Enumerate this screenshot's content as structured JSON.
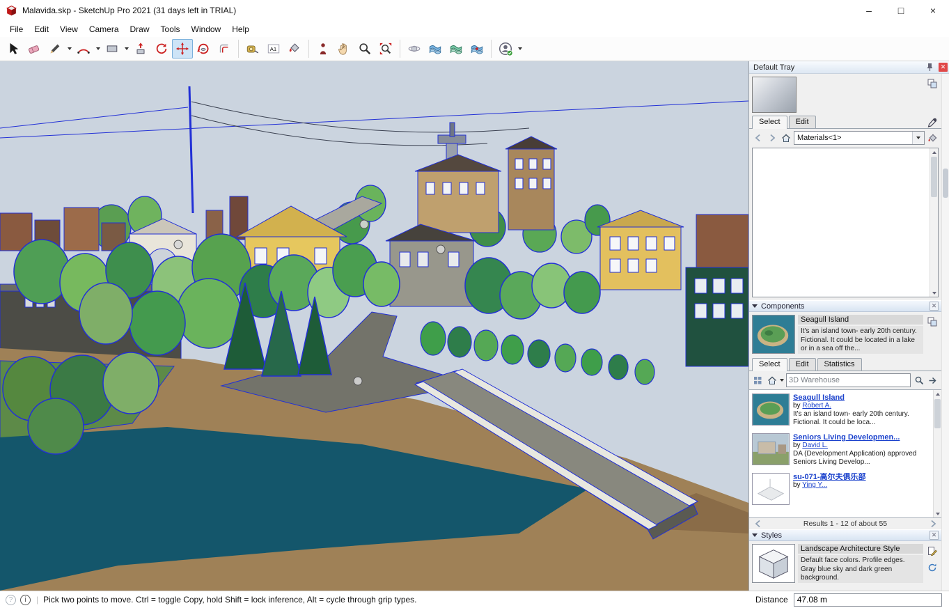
{
  "window": {
    "title": "Malavida.skp - SketchUp Pro 2021 (31 days left in TRIAL)",
    "controls": {
      "minimize": "–",
      "maximize": "□",
      "close": "×"
    }
  },
  "menu": {
    "items": [
      "File",
      "Edit",
      "View",
      "Camera",
      "Draw",
      "Tools",
      "Window",
      "Help"
    ]
  },
  "toolbar": {
    "active_tool": "move",
    "tools": [
      "select",
      "eraser",
      "line",
      "arc",
      "rectangle",
      "push-pull",
      "follow-me",
      "move",
      "rotate",
      "offset",
      "tape-measure",
      "text",
      "paint-bucket",
      "position-camera",
      "pan",
      "zoom",
      "zoom-extents",
      "orbit",
      "sandbox-from-contours",
      "sandbox-from-scratch",
      "sandbox-smoove",
      "account"
    ]
  },
  "viewport": {
    "description": "3D town model: trees with blue selection outlines, yellow and stone buildings on a hill, road intersection, bridge crossing a dark teal river, brown banks",
    "colors": {
      "sky": "#cbd4df",
      "water": "#14566b",
      "terrain": "#9f8157",
      "selection": "#2230d6"
    }
  },
  "tray": {
    "title": "Default Tray",
    "materials": {
      "tabs": [
        "Select",
        "Edit"
      ],
      "active_tab": "Select",
      "collection": "Materials<1>"
    },
    "components": {
      "title": "Components",
      "selected_name": "Seagull Island",
      "selected_description": "It's an island town- early 20th century. Fictional. It could be located in a lake or in a sea off the...",
      "tabs": [
        "Select",
        "Edit",
        "Statistics"
      ],
      "active_tab": "Select",
      "search_value": "3D Warehouse",
      "results": [
        {
          "name": "Seagull Island",
          "by": "by",
          "author": "Robert A.",
          "description": "It's an island town- early 20th century. Fictional. It could be loca..."
        },
        {
          "name": "Seniors Living Developmen...",
          "by": "by",
          "author": "David L.",
          "description": "DA (Development Application) approved Seniors Living Develop..."
        },
        {
          "name": "su-071-高尔夫俱乐部",
          "by": "by",
          "author": "Ying Y...",
          "description": ""
        }
      ],
      "results_status": "Results 1 - 12 of about 55"
    },
    "styles": {
      "title": "Styles",
      "selected_name": "Landscape Architecture Style",
      "selected_description": "Default face colors. Profile edges. Gray blue sky and dark green background."
    }
  },
  "statusbar": {
    "hint": "Pick two points to move.  Ctrl = toggle Copy, hold Shift = lock inference, Alt = cycle through grip types.",
    "measurement": {
      "label": "Distance",
      "value": "47.08 m"
    }
  }
}
